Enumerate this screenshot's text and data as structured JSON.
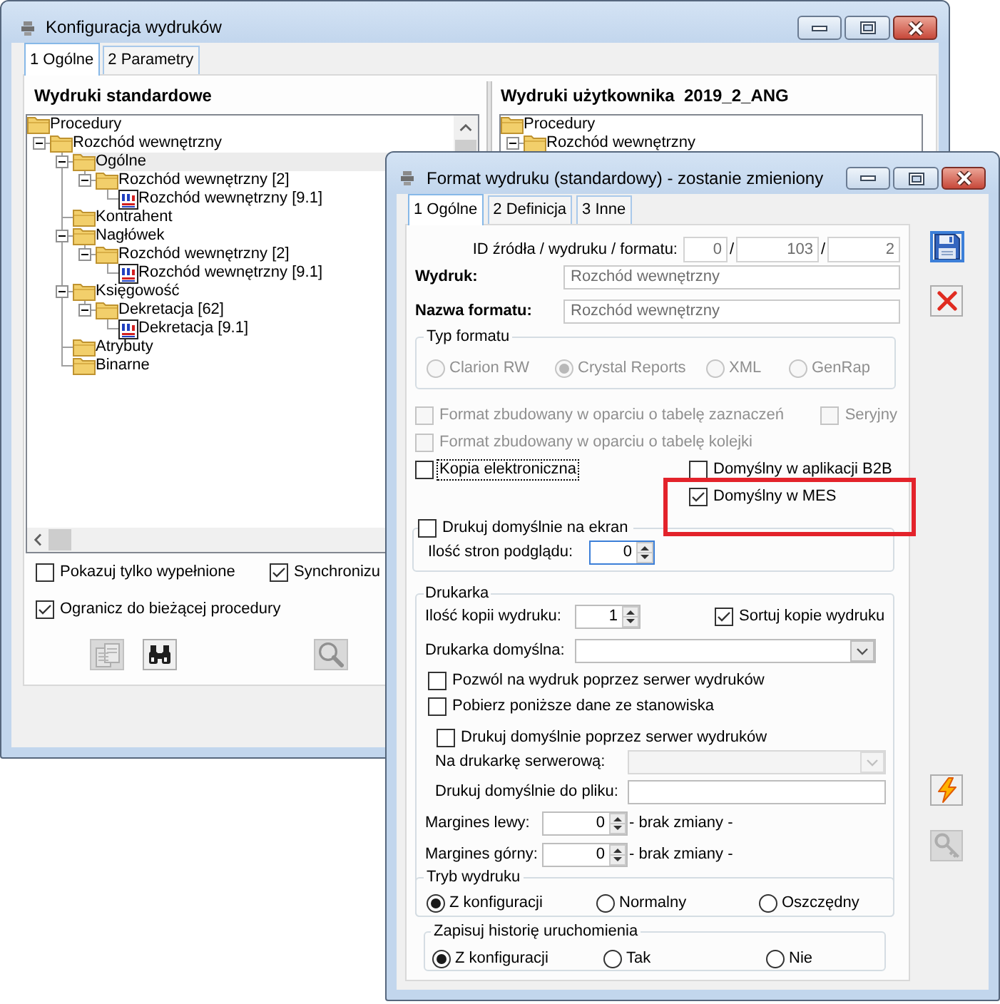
{
  "config_window": {
    "title": "Konfiguracja wydruków",
    "tabs": [
      {
        "label": "1 Ogólne",
        "selected": true
      },
      {
        "label": "2 Parametry",
        "selected": false
      }
    ],
    "standard_prints": {
      "heading": "Wydruki standardowe",
      "tree": [
        {
          "label": "Procedury",
          "kind": "folder",
          "selected": false,
          "children": [
            {
              "label": "Rozchód wewnętrzny",
              "kind": "folder",
              "selected": false,
              "expanded": true,
              "children": [
                {
                  "label": "Ogólne",
                  "kind": "folder",
                  "selected": true,
                  "expanded": true,
                  "children": [
                    {
                      "label": "Rozchód wewnętrzny [2]",
                      "kind": "folder",
                      "selected": false,
                      "expanded": true,
                      "children": [
                        {
                          "label": "Rozchód wewnętrzny [9.1]",
                          "kind": "report",
                          "selected": false
                        }
                      ]
                    }
                  ]
                },
                {
                  "label": "Kontrahent",
                  "kind": "folder",
                  "selected": false
                },
                {
                  "label": "Nagłówek",
                  "kind": "folder",
                  "selected": false,
                  "expanded": true,
                  "children": [
                    {
                      "label": "Rozchód wewnętrzny [2]",
                      "kind": "folder",
                      "selected": false,
                      "expanded": true,
                      "children": [
                        {
                          "label": "Rozchód wewnętrzny [9.1]",
                          "kind": "report",
                          "selected": false
                        }
                      ]
                    }
                  ]
                },
                {
                  "label": "Księgowość",
                  "kind": "folder",
                  "selected": false,
                  "expanded": true,
                  "children": [
                    {
                      "label": "Dekretacja [62]",
                      "kind": "folder",
                      "selected": false,
                      "expanded": true,
                      "children": [
                        {
                          "label": "Dekretacja [9.1]",
                          "kind": "report",
                          "selected": false
                        }
                      ]
                    }
                  ]
                },
                {
                  "label": "Atrybuty",
                  "kind": "folder",
                  "selected": false
                },
                {
                  "label": "Binarne",
                  "kind": "folder",
                  "selected": false
                }
              ]
            }
          ]
        }
      ]
    },
    "user_prints": {
      "heading": "Wydruki użytkownika  2019_2_ANG",
      "tree": [
        {
          "label": "Procedury",
          "kind": "folder",
          "selected": false,
          "children": [
            {
              "label": "Rozchód wewnętrzny",
              "kind": "folder",
              "selected": false,
              "expanded": true
            }
          ]
        }
      ]
    },
    "options": [
      {
        "label": "Pokazuj tylko wypełnione",
        "checked": false
      },
      {
        "label": "Synchronizu",
        "checked": true
      },
      {
        "label": "Ogranicz do bieżącej procedury",
        "checked": true
      }
    ],
    "toolbar": [
      {
        "kind": "copy",
        "disabled": true
      },
      {
        "kind": "find",
        "disabled": false
      },
      {
        "kind": "preview",
        "disabled": true
      }
    ]
  },
  "format_window": {
    "title": "Format wydruku (standardowy) - zostanie zmieniony",
    "tabs": [
      {
        "label": "1 Ogólne",
        "selected": true
      },
      {
        "label": "2 Definicja",
        "selected": false
      },
      {
        "label": "3 Inne",
        "selected": false
      }
    ],
    "ids": {
      "label": "ID źródła / wydruku / formatu:",
      "values": [
        "0",
        "103",
        "2"
      ],
      "separators": [
        "/",
        "/"
      ],
      "disabled": true
    },
    "fields": [
      {
        "label": "Wydruk:",
        "value": "Rozchód wewnętrzny",
        "disabled": true
      },
      {
        "label": "Nazwa formatu:",
        "value": "Rozchód wewnętrzny",
        "disabled": true
      }
    ],
    "format_type": {
      "title": "Typ formatu",
      "disabled": true,
      "options": [
        {
          "label": "Clarion RW",
          "selected": false
        },
        {
          "label": "Crystal Reports",
          "selected": true
        },
        {
          "label": "XML",
          "selected": false
        },
        {
          "label": "GenRap",
          "selected": false
        }
      ]
    },
    "flags": [
      {
        "label": "Format zbudowany w oparciu o tabelę zaznaczeń",
        "checked": false,
        "disabled": true,
        "focused": false,
        "highlighted": false
      },
      {
        "label": "Seryjny",
        "checked": false,
        "disabled": true,
        "focused": false,
        "highlighted": false
      },
      {
        "label": "Format zbudowany w oparciu o tabelę kolejki",
        "checked": false,
        "disabled": true,
        "focused": false,
        "highlighted": false
      },
      {
        "label": "Kopia elektroniczna",
        "checked": false,
        "disabled": false,
        "focused": true,
        "highlighted": false
      },
      {
        "label": "Domyślny w aplikacji B2B",
        "checked": false,
        "disabled": false,
        "focused": false,
        "highlighted": false
      },
      {
        "label": "Domyślny w MES",
        "checked": true,
        "disabled": false,
        "focused": false,
        "highlighted": true
      }
    ],
    "screen_print": {
      "label": "Drukuj domyślnie na ekran",
      "checked": false,
      "pages": {
        "label": "Ilość stron podglądu:",
        "value": "0",
        "focused": true
      }
    },
    "printer": {
      "title": "Drukarka",
      "copies": {
        "label": "Ilość kopii wydruku:",
        "value": "1"
      },
      "sort_copies": {
        "label": "Sortuj kopie wydruku",
        "checked": true
      },
      "default_printer": {
        "label": "Drukarka domyślna:",
        "disabled": false
      },
      "options": [
        {
          "label": "Pozwól na wydruk poprzez serwer wydruków",
          "checked": false
        },
        {
          "label": "Pobierz poniższe dane ze stanowiska",
          "checked": false
        }
      ],
      "server_default": {
        "label": "Drukuj domyślnie poprzez serwer wydruków",
        "checked": false
      },
      "server_printer": {
        "label": "Na drukarkę serwerową:",
        "disabled": true
      },
      "file": {
        "label": "Drukuj domyślnie do pliku:"
      },
      "margins": [
        {
          "label": "Margines lewy:",
          "value": "0",
          "note": "- brak zmiany -"
        },
        {
          "label": "Margines górny:",
          "value": "0",
          "note": "- brak zmiany -"
        }
      ],
      "mode": {
        "title": "Tryb wydruku",
        "options": [
          {
            "label": "Z konfiguracji",
            "selected": true
          },
          {
            "label": "Normalny",
            "selected": false
          },
          {
            "label": "Oszczędny",
            "selected": false
          }
        ]
      }
    },
    "history": {
      "title": "Zapisuj historię uruchomienia",
      "options": [
        {
          "label": "Z konfiguracji",
          "selected": true
        },
        {
          "label": "Tak",
          "selected": false
        },
        {
          "label": "Nie",
          "selected": false
        }
      ]
    },
    "side_buttons": {
      "upper": [
        {
          "kind": "save",
          "focused": true,
          "disabled": false
        },
        {
          "kind": "cancel",
          "focused": false,
          "disabled": false
        }
      ],
      "lower": [
        {
          "kind": "execute",
          "focused": false,
          "disabled": false
        },
        {
          "kind": "key",
          "focused": false,
          "disabled": true
        }
      ]
    }
  }
}
